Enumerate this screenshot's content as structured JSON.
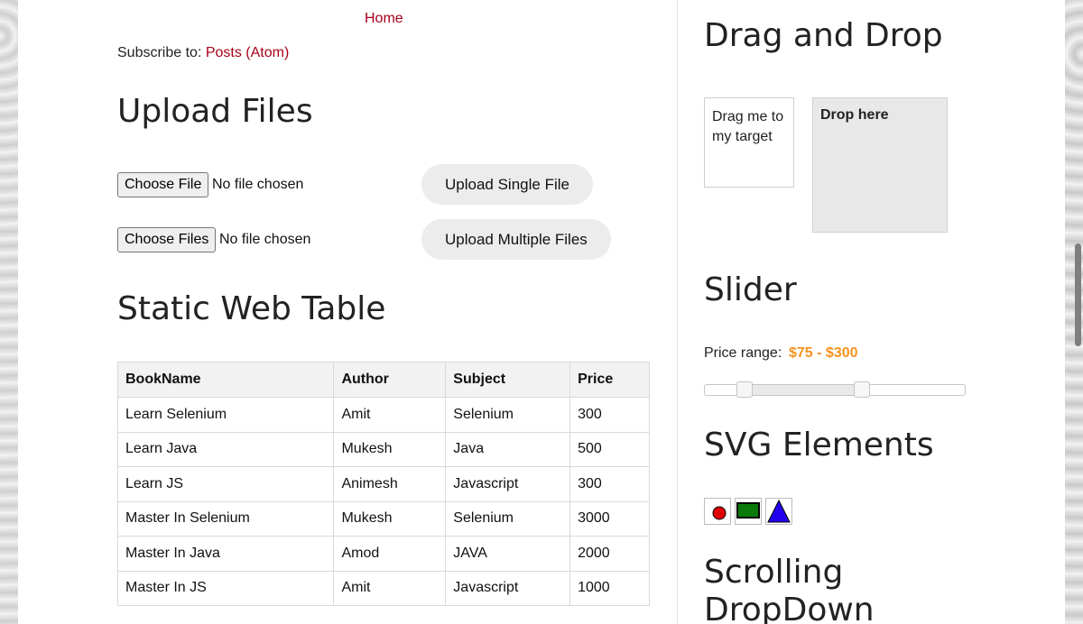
{
  "nav": {
    "home": "Home"
  },
  "subscribe": {
    "prefix": "Subscribe to: ",
    "link": "Posts (Atom)"
  },
  "upload": {
    "heading": "Upload Files",
    "single": {
      "choose_label": "Choose File",
      "status": "No file chosen",
      "button": "Upload Single File"
    },
    "multiple": {
      "choose_label": "Choose Files",
      "status": "No file chosen",
      "button": "Upload Multiple Files"
    }
  },
  "table": {
    "heading": "Static Web Table",
    "columns": [
      "BookName",
      "Author",
      "Subject",
      "Price"
    ],
    "rows": [
      [
        "Learn Selenium",
        "Amit",
        "Selenium",
        "300"
      ],
      [
        "Learn Java",
        "Mukesh",
        "Java",
        "500"
      ],
      [
        "Learn JS",
        "Animesh",
        "Javascript",
        "300"
      ],
      [
        "Master In Selenium",
        "Mukesh",
        "Selenium",
        "3000"
      ],
      [
        "Master In Java",
        "Amod",
        "JAVA",
        "2000"
      ],
      [
        "Master In JS",
        "Amit",
        "Javascript",
        "1000"
      ]
    ]
  },
  "drag_drop": {
    "heading": "Drag and Drop",
    "draggable": "Drag me to my target",
    "droppable": "Drop here"
  },
  "slider": {
    "heading": "Slider",
    "label": "Price range:",
    "value_text": "$75 - $300",
    "min_fraction": 0.15,
    "max_fraction": 0.6
  },
  "svg": {
    "heading": "SVG Elements",
    "icons": [
      "circle-icon",
      "rectangle-icon",
      "triangle-icon"
    ],
    "colors": {
      "circle": "#e00000",
      "rect": "#0a7a0a",
      "triangle": "#2200ee"
    }
  },
  "scrolling": {
    "heading_line1": "Scrolling",
    "heading_line2": "DropDown"
  },
  "colors": {
    "link": "#a8001a",
    "accent_orange": "#f6931f"
  }
}
